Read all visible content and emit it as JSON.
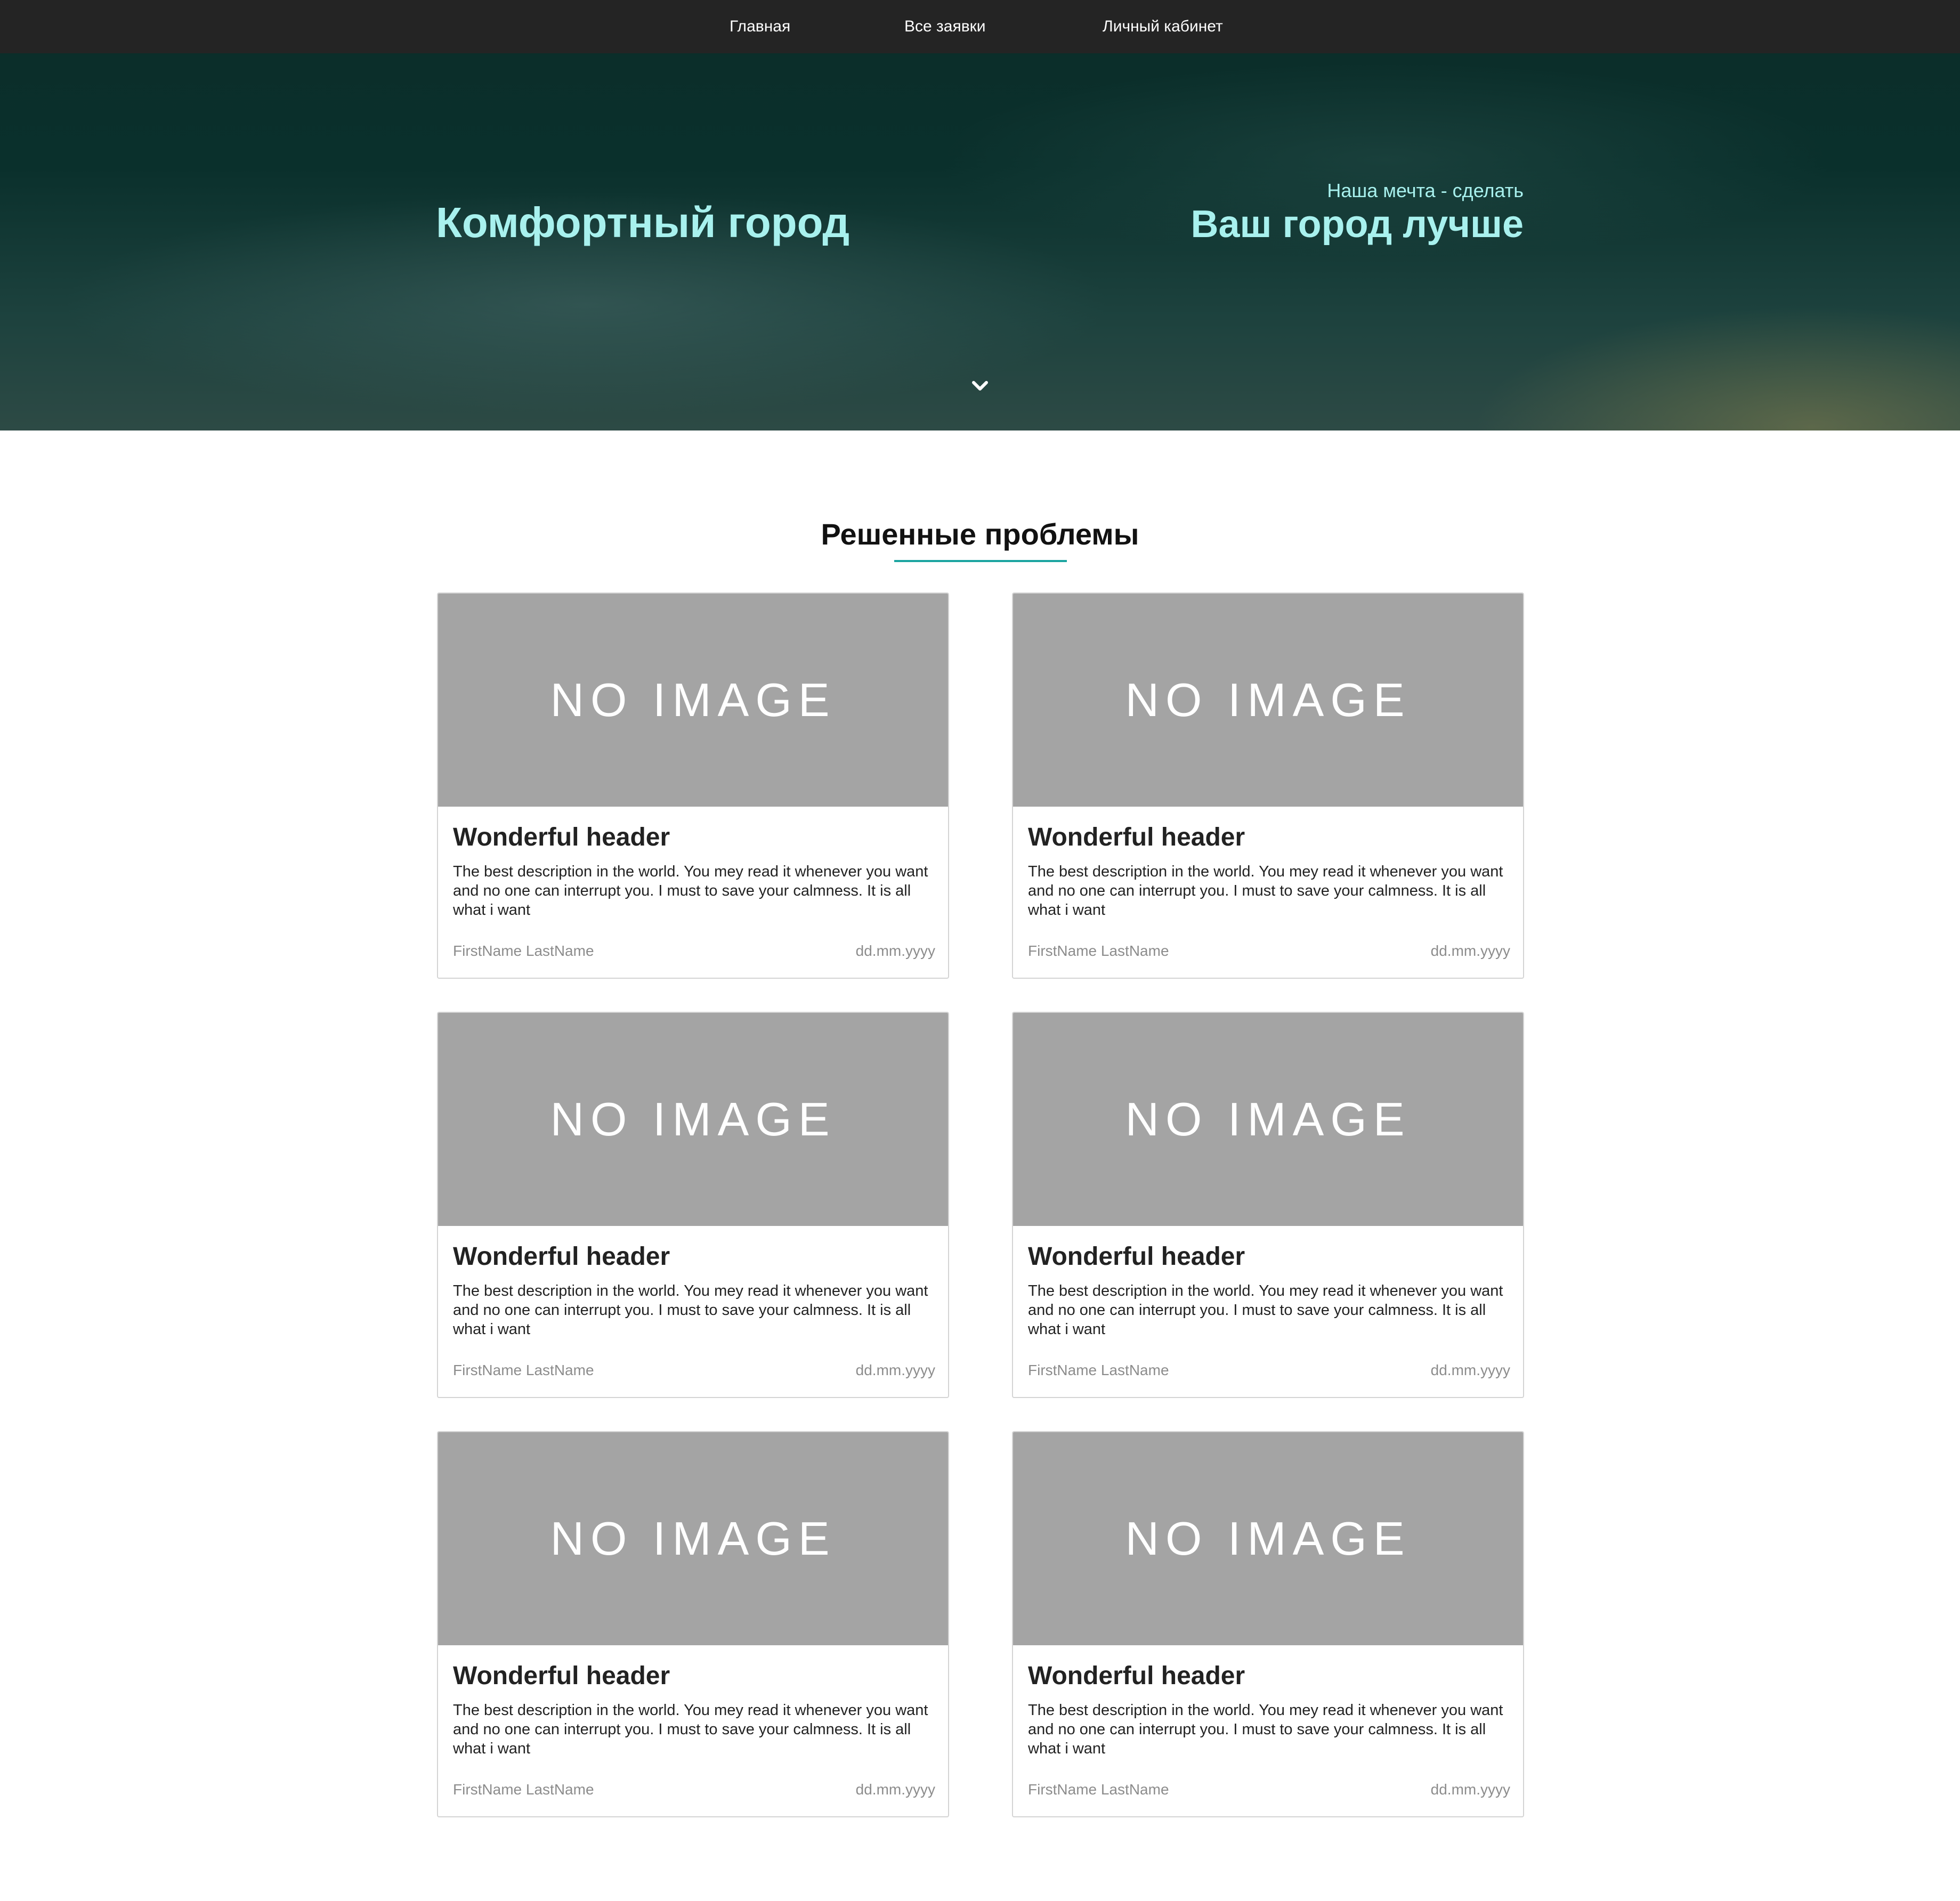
{
  "nav": {
    "items": [
      {
        "label": "Главная"
      },
      {
        "label": "Все заявки"
      },
      {
        "label": "Личный кабинет"
      }
    ]
  },
  "hero": {
    "title_left": "Комфортный город",
    "subtitle_right": "Наша мечта - сделать",
    "title_right": "Ваш город лучше",
    "scroll_icon": "chevron-down-icon"
  },
  "section": {
    "title": "Решенные проблемы",
    "accent_color": "#1ba4a0"
  },
  "cards": [
    {
      "image_text": "NO IMAGE",
      "title": "Wonderful header",
      "description": "The best description in the world. You mey read it whenever you want and no one can interrupt you. I must to save your calmness. It is all what i want",
      "author": "FirstName LastName",
      "date": "dd.mm.yyyy"
    },
    {
      "image_text": "NO IMAGE",
      "title": "Wonderful header",
      "description": "The best description in the world. You mey read it whenever you want and no one can interrupt you. I must to save your calmness. It is all what i want",
      "author": "FirstName LastName",
      "date": "dd.mm.yyyy"
    },
    {
      "image_text": "NO IMAGE",
      "title": "Wonderful header",
      "description": "The best description in the world. You mey read it whenever you want and no one can interrupt you. I must to save your calmness. It is all what i want",
      "author": "FirstName LastName",
      "date": "dd.mm.yyyy"
    },
    {
      "image_text": "NO IMAGE",
      "title": "Wonderful header",
      "description": "The best description in the world. You mey read it whenever you want and no one can interrupt you. I must to save your calmness. It is all what i want",
      "author": "FirstName LastName",
      "date": "dd.mm.yyyy"
    },
    {
      "image_text": "NO IMAGE",
      "title": "Wonderful header",
      "description": "The best description in the world. You mey read it whenever you want and no one can interrupt you. I must to save your calmness. It is all what i want",
      "author": "FirstName LastName",
      "date": "dd.mm.yyyy"
    },
    {
      "image_text": "NO IMAGE",
      "title": "Wonderful header",
      "description": "The best description in the world. You mey read it whenever you want and no one can interrupt you. I must to save your calmness. It is all what i want",
      "author": "FirstName LastName",
      "date": "dd.mm.yyyy"
    }
  ]
}
